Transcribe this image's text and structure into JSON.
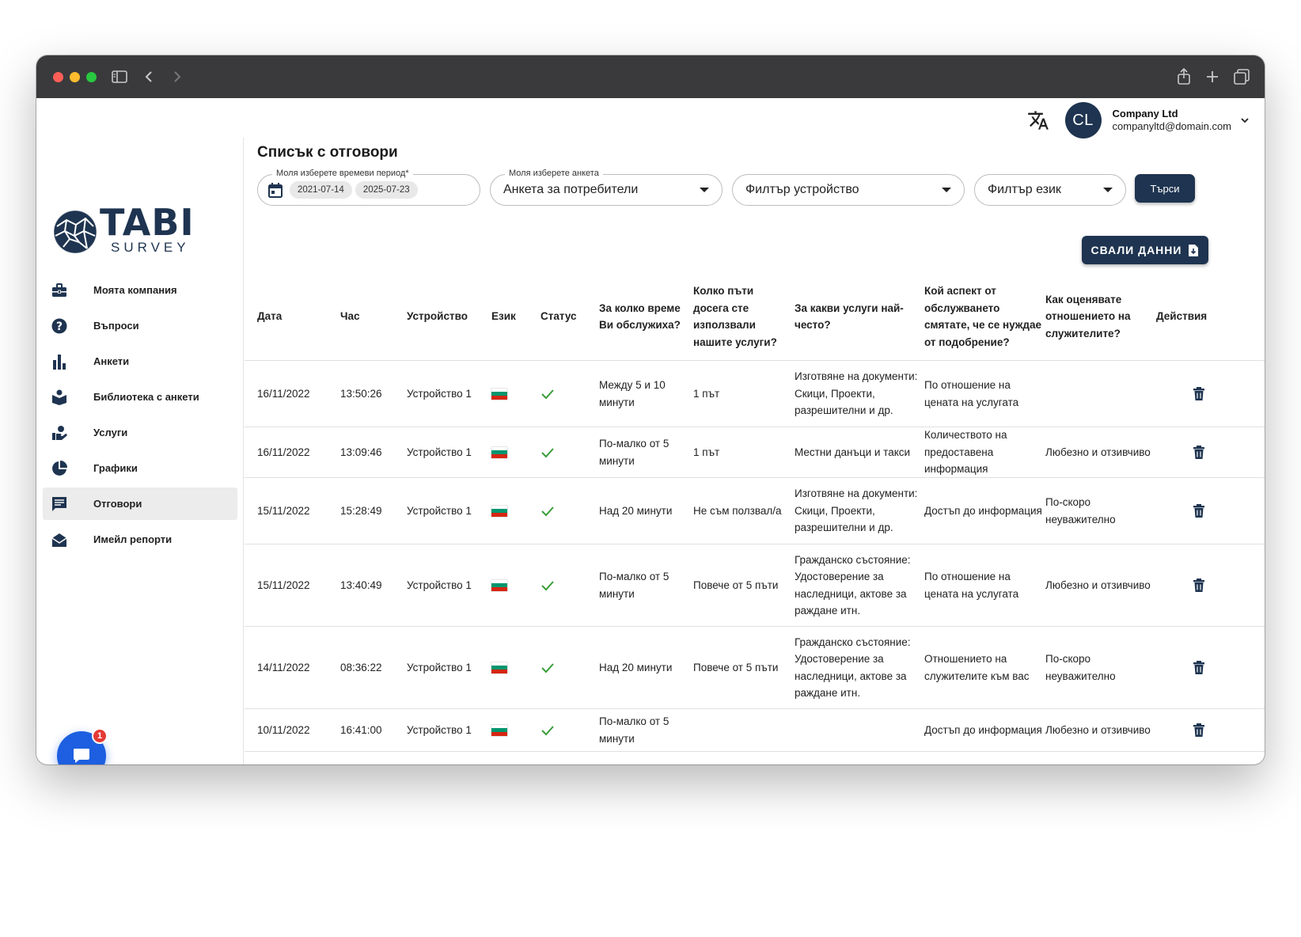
{
  "header": {
    "translate_icon": "translate-icon",
    "avatar_initials": "CL",
    "user_name": "Company Ltd",
    "user_email": "companyltd@domain.com"
  },
  "logo": {
    "title": "TABI",
    "subtitle": "SURVEY"
  },
  "sidebar": {
    "items": [
      {
        "label": "Моята компания",
        "icon": "briefcase-icon"
      },
      {
        "label": "Въпроси",
        "icon": "help-circle-icon"
      },
      {
        "label": "Анкети",
        "icon": "bar-chart-icon"
      },
      {
        "label": "Библиотека с анкети",
        "icon": "library-icon"
      },
      {
        "label": "Услуги",
        "icon": "hand-service-icon"
      },
      {
        "label": "Графики",
        "icon": "pie-chart-icon"
      },
      {
        "label": "Отговори",
        "icon": "message-icon",
        "active": true
      },
      {
        "label": "Имейл репорти",
        "icon": "email-open-icon"
      }
    ],
    "chat_badge": "1"
  },
  "main": {
    "title": "Списък с отговори",
    "filters": {
      "period_label": "Моля изберете времеви период*",
      "date_from": "2021-07-14",
      "date_to": "2025-07-23",
      "survey_label": "Моля изберете анкета",
      "survey_value": "Анкета за потребители",
      "device_value": "Филтър устройство",
      "language_value": "Филтър език"
    },
    "search_label": "Търси",
    "download_label": "СВАЛИ ДАННИ"
  },
  "table": {
    "columns": [
      "Дата",
      "Час",
      "Устройство",
      "Език",
      "Статус",
      "За колко време Ви обслужиха?",
      "Колко пъти досега сте използвали нашите услуги?",
      "За какви услуги най-често?",
      "Кой аспект от обслужването смятате, че се нуждае от подобрение?",
      "Как оценявате отношението на служителите?",
      "Действия"
    ],
    "rows": [
      {
        "date": "16/11/2022",
        "time": "13:50:26",
        "device": "Устройство 1",
        "lang": "bg",
        "status": "ok",
        "q1": "Между 5 и 10 минути",
        "q2": "1 път",
        "q3": "Изготвяне на документи: Скици, Проекти, разрешителни и др.",
        "q4": "По отношение на цената на услугата",
        "q5": ""
      },
      {
        "date": "16/11/2022",
        "time": "13:09:46",
        "device": "Устройство 1",
        "lang": "bg",
        "status": "ok",
        "q1": "По-малко от 5 минути",
        "q2": "1 път",
        "q3": "Местни данъци и такси",
        "q4": "Количеството на предоставена информация",
        "q5": "Любезно и отзивчиво"
      },
      {
        "date": "15/11/2022",
        "time": "15:28:49",
        "device": "Устройство 1",
        "lang": "bg",
        "status": "ok",
        "q1": "Над 20 минути",
        "q2": "Не съм ползвал/а",
        "q3": "Изготвяне на документи: Скици, Проекти, разрешителни и др.",
        "q4": "Достъп до информация",
        "q5": "По-скоро неуважително"
      },
      {
        "date": "15/11/2022",
        "time": "13:40:49",
        "device": "Устройство 1",
        "lang": "bg",
        "status": "ok",
        "q1": "По-малко от 5 минути",
        "q2": "Повече от 5 пъти",
        "q3": "Гражданско състояние: Удостоверение за наследници, актове за раждане итн.",
        "q4": "По отношение на цената на услугата",
        "q5": "Любезно и отзивчиво"
      },
      {
        "date": "14/11/2022",
        "time": "08:36:22",
        "device": "Устройство 1",
        "lang": "bg",
        "status": "ok",
        "q1": "Над 20 минути",
        "q2": "Повече от 5 пъти",
        "q3": "Гражданско състояние: Удостоверение за наследници, актове за раждане итн.",
        "q4": "Отношението на служителите към вас",
        "q5": "По-скоро неуважително"
      },
      {
        "date": "10/11/2022",
        "time": "16:41:00",
        "device": "Устройство 1",
        "lang": "bg",
        "status": "ok",
        "q1": "По-малко от 5 минути",
        "q2": "",
        "q3": "",
        "q4": "Достъп до информация",
        "q5": "Любезно и отзивчиво"
      }
    ]
  },
  "colors": {
    "brand": "#1e3450",
    "accent_blue": "#1d5fe0",
    "check_green": "#3a9d3a",
    "flag_white": "#ffffff",
    "flag_green": "#00966e",
    "flag_red": "#d62612"
  }
}
